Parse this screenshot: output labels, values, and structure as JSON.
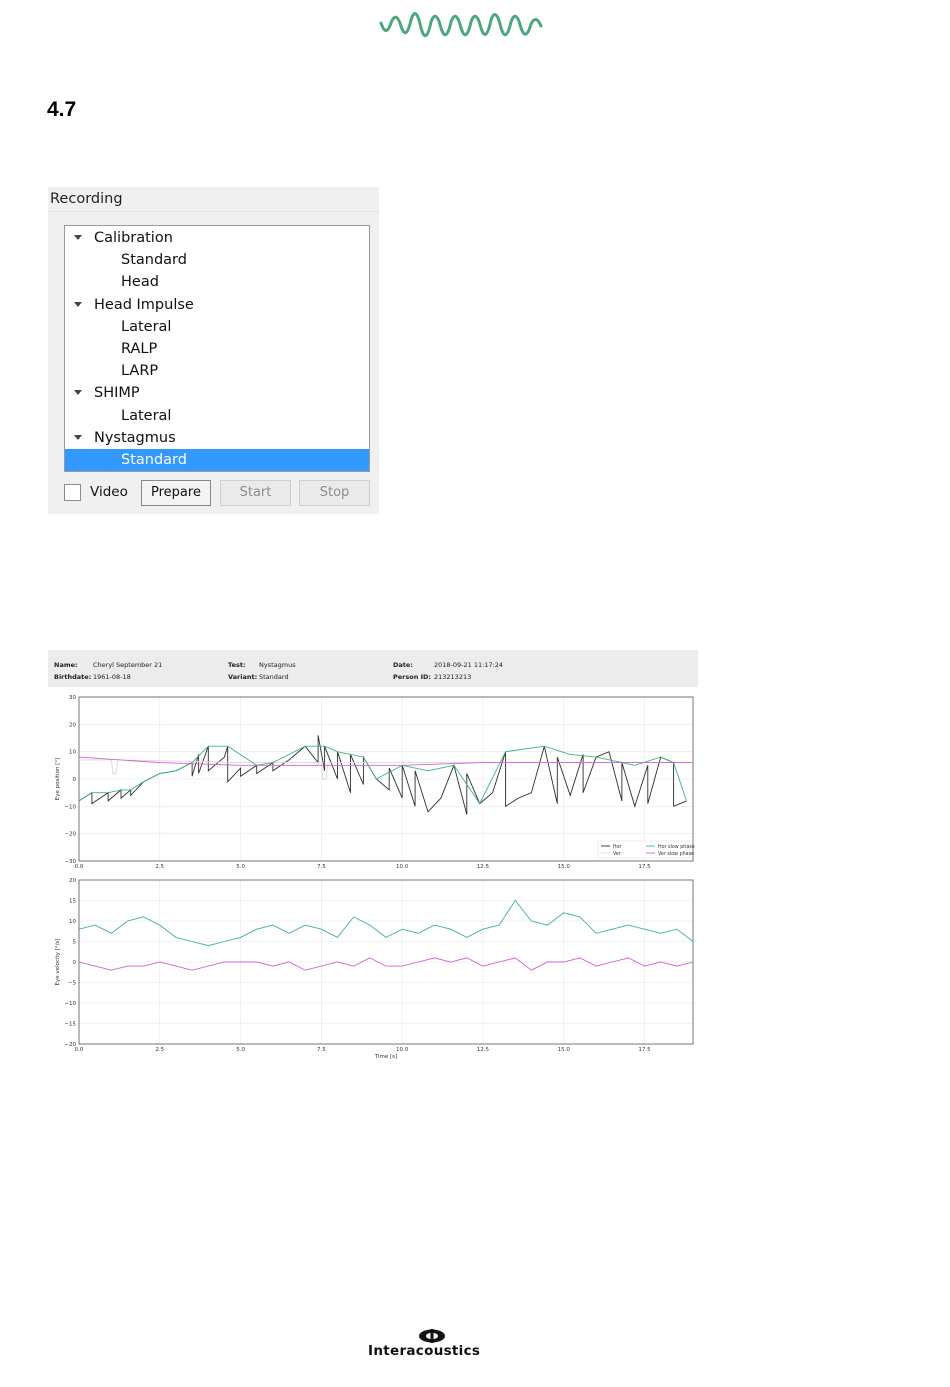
{
  "page": {
    "section_number": "4.7",
    "brand": "Interacoustics"
  },
  "recording_panel": {
    "title": "Recording",
    "tree": [
      {
        "label": "Calibration",
        "level": 0,
        "expanded": true
      },
      {
        "label": "Standard",
        "level": 1
      },
      {
        "label": "Head",
        "level": 1
      },
      {
        "label": "Head Impulse",
        "level": 0,
        "expanded": true
      },
      {
        "label": "Lateral",
        "level": 1
      },
      {
        "label": "RALP",
        "level": 1
      },
      {
        "label": "LARP",
        "level": 1
      },
      {
        "label": "SHIMP",
        "level": 0,
        "expanded": true
      },
      {
        "label": "Lateral",
        "level": 1
      },
      {
        "label": "Nystagmus",
        "level": 0,
        "expanded": true
      },
      {
        "label": "Standard",
        "level": 1,
        "selected": true
      }
    ],
    "video_label": "Video",
    "video_checked": false,
    "prepare_label": "Prepare",
    "start_label": "Start",
    "stop_label": "Stop",
    "selection_color": "#3399ff"
  },
  "report": {
    "name_label": "Name:",
    "name_value": "Cheryl  September 21",
    "birthdate_label": "Birthdate:",
    "birthdate_value": "1961-08-18",
    "test_label": "Test:",
    "test_value": "Nystagmus",
    "variant_label": "Variant:",
    "variant_value": "Standard",
    "date_label": "Date:",
    "date_value": "2018-09-21 11:17:24",
    "person_id_label": "Person ID:",
    "person_id_value": "213213213"
  },
  "chart_data": [
    {
      "type": "line",
      "ylabel": "Eye position [°]",
      "xlabel": "",
      "ylim": [
        -10,
        30
      ],
      "yticks": [
        "30",
        "20",
        "10",
        "0",
        "−10",
        "−20",
        "−30"
      ],
      "yticks_values": [
        30,
        20,
        10,
        0,
        -10,
        -20,
        -30
      ],
      "xlim": [
        0,
        19
      ],
      "xticks": [
        "0.0",
        "2.5",
        "5.0",
        "7.5",
        "10.0",
        "12.5",
        "15.0",
        "17.5"
      ],
      "xticks_values": [
        0,
        2.5,
        5,
        7.5,
        10,
        12.5,
        15,
        17.5
      ],
      "grid": true,
      "legend_position": "bottom-right",
      "legend": [
        "Hor",
        "Ver",
        "Hor slow phase",
        "Ver slow phase"
      ],
      "colors": {
        "hor": "#2e2e2e",
        "ver": "#d9d9d9",
        "hor_slow": "#3cb878",
        "ver_slow": "#d45fd4"
      },
      "series": [
        {
          "name": "Hor",
          "x": [
            0.0,
            0.4,
            0.4,
            0.9,
            0.9,
            1.3,
            1.3,
            1.6,
            1.6,
            2.0,
            2.5,
            3.0,
            3.5,
            3.5,
            3.7,
            3.7,
            4.0,
            4.0,
            4.5,
            4.6,
            4.6,
            5.0,
            5.0,
            5.5,
            5.5,
            6.0,
            6.0,
            6.5,
            7.0,
            7.4,
            7.4,
            7.6,
            7.6,
            8.0,
            8.0,
            8.4,
            8.4,
            8.8,
            8.8,
            9.2,
            9.6,
            9.6,
            10.0,
            10.0,
            10.4,
            10.4,
            10.8,
            11.2,
            11.6,
            12.0,
            12.0,
            12.4,
            12.8,
            13.2,
            13.2,
            13.6,
            14.0,
            14.4,
            14.8,
            14.8,
            15.2,
            15.6,
            15.6,
            16.0,
            16.4,
            16.8,
            16.8,
            17.2,
            17.6,
            17.6,
            18.0,
            18.4,
            18.4,
            18.8
          ],
          "y": [
            -8,
            -5,
            -9,
            -5,
            -8,
            -4,
            -7,
            -4,
            -6,
            -1,
            2,
            3,
            6,
            1,
            9,
            2,
            12,
            3,
            8,
            12,
            -1,
            4,
            1,
            5,
            2,
            6,
            3,
            7,
            12,
            6,
            16,
            3,
            12,
            0,
            10,
            -5,
            9,
            -2,
            8,
            0,
            -4,
            4,
            -7,
            5,
            -10,
            3,
            -12,
            -7,
            5,
            -13,
            2,
            -9,
            -5,
            10,
            -10,
            -7,
            -5,
            12,
            -9,
            8,
            -6,
            9,
            -5,
            8,
            10,
            -8,
            6,
            -10,
            5,
            -9,
            8,
            6,
            -10,
            -8
          ]
        },
        {
          "name": "Ver",
          "x": [
            0,
            1.0,
            1.05,
            1.15,
            1.2,
            5,
            7.5,
            7.55,
            7.65,
            7.7,
            10,
            12.5,
            15,
            17.5,
            19
          ],
          "y": [
            7,
            7,
            2,
            2,
            7,
            6,
            6,
            0,
            0,
            6,
            6,
            6,
            6,
            6,
            6
          ]
        },
        {
          "name": "Hor slow phase",
          "x": [
            0.0,
            0.4,
            0.9,
            1.3,
            1.6,
            2.0,
            2.5,
            3.0,
            3.5,
            4.0,
            4.6,
            5.5,
            6.0,
            7.0,
            7.6,
            8.0,
            8.4,
            8.8,
            9.2,
            10.0,
            10.8,
            11.6,
            12.4,
            13.2,
            14.4,
            15.2,
            16.0,
            16.8,
            17.2,
            18.0,
            18.4,
            18.8
          ],
          "y": [
            -8,
            -5,
            -5,
            -4,
            -4,
            -1,
            2,
            3,
            6,
            12,
            12,
            5,
            6,
            12,
            12,
            10,
            9,
            8,
            0,
            5,
            3,
            5,
            -9,
            10,
            12,
            9,
            8,
            6,
            5,
            8,
            6,
            -8
          ]
        },
        {
          "name": "Ver slow phase",
          "x": [
            0,
            2.5,
            5,
            7.5,
            10,
            12.5,
            15,
            17.5,
            19
          ],
          "y": [
            8,
            6,
            5,
            5,
            5,
            6,
            6,
            6,
            6
          ]
        }
      ]
    },
    {
      "type": "line",
      "ylabel": "Eye velocity [°/s]",
      "xlabel": "Time [s]",
      "ylim": [
        -20,
        20
      ],
      "yticks": [
        "20",
        "15",
        "10",
        "5",
        "0",
        "−5",
        "−10",
        "−15",
        "−20"
      ],
      "yticks_values": [
        20,
        15,
        10,
        5,
        0,
        -5,
        -10,
        -15,
        -20
      ],
      "xlim": [
        0,
        19
      ],
      "xticks": [
        "0.0",
        "2.5",
        "5.0",
        "7.5",
        "10.0",
        "12.5",
        "15.0",
        "17.5"
      ],
      "xticks_values": [
        0,
        2.5,
        5,
        7.5,
        10,
        12.5,
        15,
        17.5
      ],
      "grid": true,
      "colors": {
        "hor_slow": "#3cb878",
        "ver_slow": "#d45fd4"
      },
      "series": [
        {
          "name": "Hor slow phase",
          "x": [
            0.0,
            0.5,
            1.0,
            1.5,
            2.0,
            2.5,
            3.0,
            3.5,
            4.0,
            4.5,
            5.0,
            5.5,
            6.0,
            6.5,
            7.0,
            7.5,
            8.0,
            8.5,
            9.0,
            9.5,
            10.0,
            10.5,
            11.0,
            11.5,
            12.0,
            12.5,
            13.0,
            13.5,
            14.0,
            14.5,
            15.0,
            15.5,
            16.0,
            16.5,
            17.0,
            17.5,
            18.0,
            18.5,
            19.0
          ],
          "y": [
            8,
            9,
            7,
            10,
            11,
            9,
            6,
            5,
            4,
            5,
            6,
            8,
            9,
            7,
            9,
            8,
            6,
            11,
            9,
            6,
            8,
            7,
            9,
            8,
            6,
            8,
            9,
            15,
            10,
            9,
            12,
            11,
            7,
            8,
            9,
            8,
            7,
            8,
            5
          ]
        },
        {
          "name": "Ver slow phase",
          "x": [
            0.0,
            0.5,
            1.0,
            1.5,
            2.0,
            2.5,
            3.0,
            3.5,
            4.0,
            4.5,
            5.0,
            5.5,
            6.0,
            6.5,
            7.0,
            7.5,
            8.0,
            8.5,
            9.0,
            9.5,
            10.0,
            10.5,
            11.0,
            11.5,
            12.0,
            12.5,
            13.0,
            13.5,
            14.0,
            14.5,
            15.0,
            15.5,
            16.0,
            16.5,
            17.0,
            17.5,
            18.0,
            18.5,
            19.0
          ],
          "y": [
            0,
            -1,
            -2,
            -1,
            -1,
            0,
            -1,
            -2,
            -1,
            0,
            0,
            0,
            -1,
            0,
            -2,
            -1,
            0,
            -1,
            1,
            -1,
            -1,
            0,
            1,
            0,
            1,
            -1,
            0,
            1,
            -2,
            0,
            0,
            1,
            -1,
            0,
            1,
            -1,
            0,
            -1,
            0
          ]
        }
      ]
    }
  ]
}
